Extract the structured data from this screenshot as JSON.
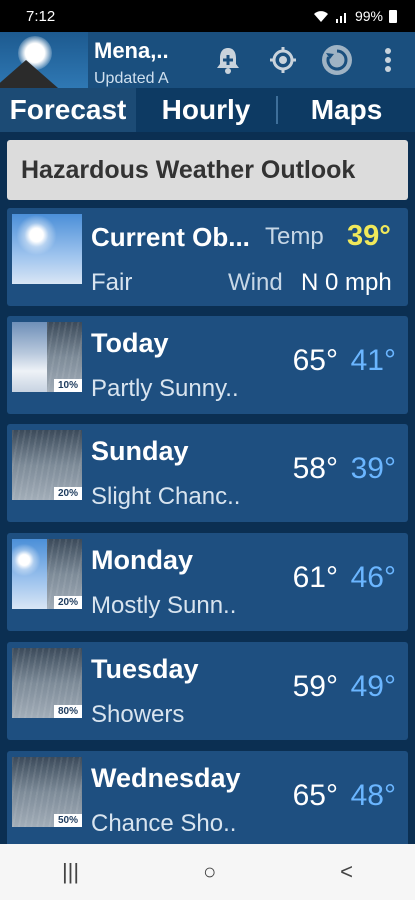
{
  "status_bar": {
    "time": "7:12",
    "battery": "99%"
  },
  "header": {
    "title": "Mena,..",
    "subtitle": "Updated A"
  },
  "tabs": [
    {
      "label": "Forecast"
    },
    {
      "label": "Hourly"
    },
    {
      "label": "Maps"
    }
  ],
  "hazard": {
    "label": "Hazardous Weather Outlook"
  },
  "current": {
    "title": "Current Ob...",
    "condition": "Fair",
    "temp_label": "Temp",
    "temp_value": "39°",
    "wind_label": "Wind",
    "wind_value": "N 0 mph"
  },
  "forecast": [
    {
      "day": "Today",
      "desc": "Partly Sunny..",
      "high": "65°",
      "low": "41°",
      "pop": "10%"
    },
    {
      "day": "Sunday",
      "desc": "Slight Chanc..",
      "high": "58°",
      "low": "39°",
      "pop": "20%"
    },
    {
      "day": "Monday",
      "desc": "Mostly Sunn..",
      "high": "61°",
      "low": "46°",
      "pop": "20%"
    },
    {
      "day": "Tuesday",
      "desc": "Showers",
      "high": "59°",
      "low": "49°",
      "pop": "80%"
    },
    {
      "day": "Wednesday",
      "desc": "Chance Sho..",
      "high": "65°",
      "low": "48°",
      "pop": "50%"
    }
  ],
  "nav": {
    "recents_icon": "|||",
    "home_icon": "○",
    "back_icon": "<"
  },
  "colors": {
    "temp_current": "#f0e85a",
    "low_temp": "#6bb6ff",
    "card_bg": "#1e4f80"
  }
}
